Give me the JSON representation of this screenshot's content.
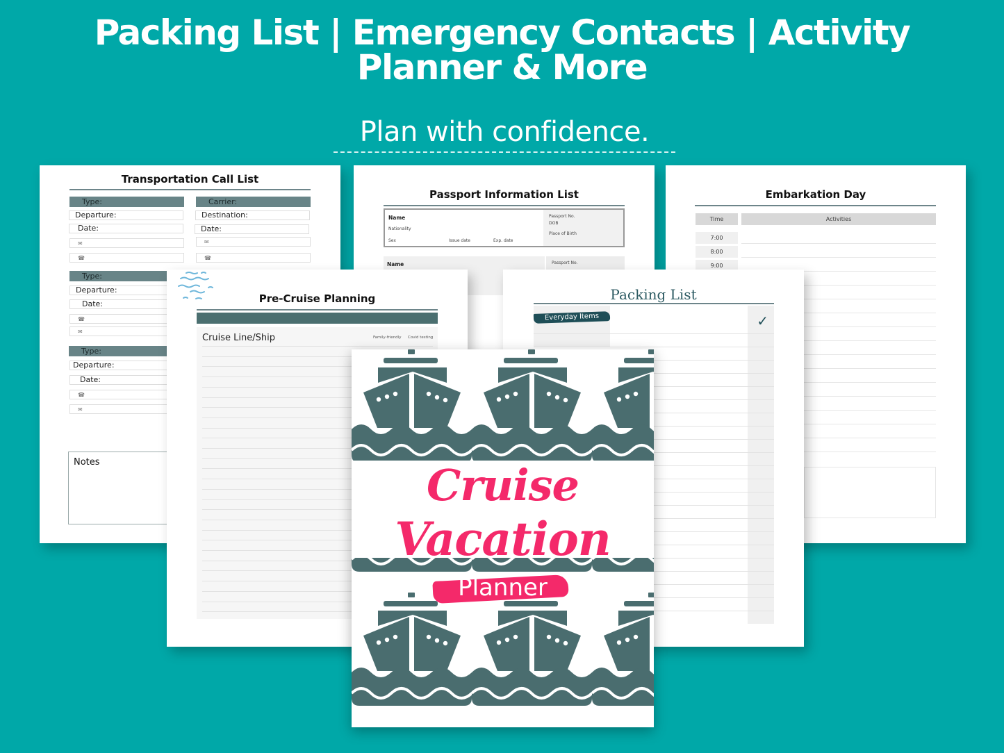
{
  "header": {
    "headline_line1": "Packing List | Emergency Contacts | Activity",
    "headline_line2": "Planner & More",
    "tagline": "Plan with confidence."
  },
  "colors": {
    "background": "#00a8a8",
    "accent_teal_dark": "#4b6f70",
    "cover_pink": "#f4296a",
    "packing_navy": "#1e4e57"
  },
  "transport_page": {
    "title": "Transportation Call List",
    "blocks": [
      {
        "head": "Type:",
        "departure": "Departure:",
        "date": "Date:",
        "icons": [
          "mail-icon",
          "phone-icon"
        ]
      },
      {
        "head": "Carrier:",
        "departure": "Destination:",
        "date": "Date:",
        "icons": [
          "mail-icon",
          "phone-icon"
        ]
      },
      {
        "head": "Type:",
        "departure": "Departure:",
        "date": "Date:",
        "icons": [
          "phone-icon",
          "mail-icon"
        ]
      },
      {
        "head": "Type:",
        "departure": "Departure:",
        "date": "Date:",
        "icons": [
          "phone-icon",
          "mail-icon"
        ]
      }
    ],
    "notes_label": "Notes"
  },
  "passport_page": {
    "title": "Passport Information List",
    "fields": {
      "name": "Name",
      "nationality": "Nationality",
      "sex": "Sex",
      "issue_date": "Issue date",
      "exp_date": "Exp. date",
      "passport_no": "Passport No.",
      "dob": "DOB",
      "place_of_birth": "Place of Birth"
    }
  },
  "embark_page": {
    "title": "Embarkation Day",
    "col_time": "Time",
    "col_activities": "Activities",
    "times": [
      "7:00",
      "8:00",
      "9:00"
    ]
  },
  "precruise_page": {
    "title": "Pre-Cruise Planning",
    "row_label": "Cruise Line/Ship",
    "col_family": "Family-friendly",
    "col_covid": "Covid testing"
  },
  "packing_page": {
    "title": "Packing List",
    "category": "Everyday Items",
    "check_icon": "checkmark-icon"
  },
  "cover": {
    "title_line1": "Cruise",
    "title_line2": "Vacation",
    "subtitle": "Planner"
  }
}
